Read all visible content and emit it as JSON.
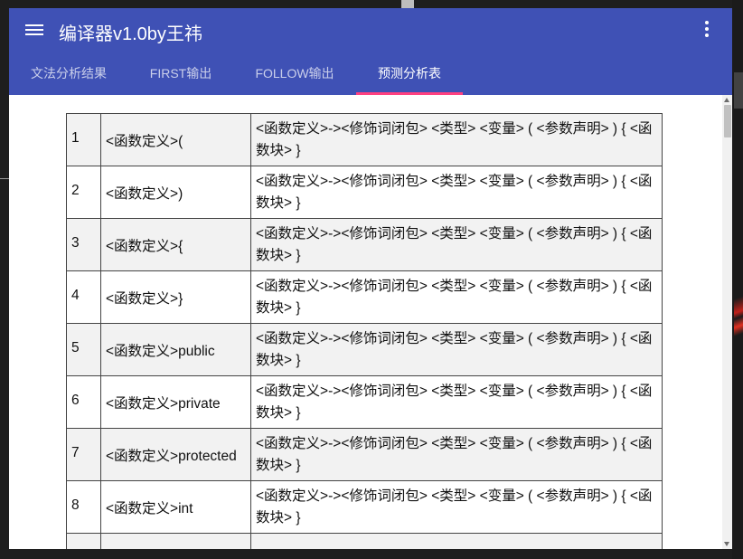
{
  "app": {
    "title": "编译器v1.0by王祎"
  },
  "tabs": [
    {
      "label": "文法分析结果",
      "active": false
    },
    {
      "label": "FIRST输出",
      "active": false
    },
    {
      "label": "FOLLOW输出",
      "active": false
    },
    {
      "label": "预测分析表",
      "active": true
    }
  ],
  "colors": {
    "appbar": "#3f51b5",
    "indicator": "#ff4081"
  },
  "icons": {
    "menu": "menu-icon",
    "more": "more-vert-icon"
  },
  "table": {
    "rows": [
      {
        "no": "1",
        "key": "<函数定义>(",
        "production": "<函数定义>-><修饰词闭包> <类型> <变量> ( <参数声明> ) { <函数块> }"
      },
      {
        "no": "2",
        "key": "<函数定义>)",
        "production": "<函数定义>-><修饰词闭包> <类型> <变量> ( <参数声明> ) { <函数块> }"
      },
      {
        "no": "3",
        "key": "<函数定义>{",
        "production": "<函数定义>-><修饰词闭包> <类型> <变量> ( <参数声明> ) { <函数块> }"
      },
      {
        "no": "4",
        "key": "<函数定义>}",
        "production": "<函数定义>-><修饰词闭包> <类型> <变量> ( <参数声明> ) { <函数块> }"
      },
      {
        "no": "5",
        "key": "<函数定义>public",
        "production": "<函数定义>-><修饰词闭包> <类型> <变量> ( <参数声明> ) { <函数块> }"
      },
      {
        "no": "6",
        "key": "<函数定义>private",
        "production": "<函数定义>-><修饰词闭包> <类型> <变量> ( <参数声明> ) { <函数块> }"
      },
      {
        "no": "7",
        "key": "<函数定义>protected",
        "production": "<函数定义>-><修饰词闭包> <类型> <变量> ( <参数声明> ) { <函数块> }"
      },
      {
        "no": "8",
        "key": "<函数定义>int",
        "production": "<函数定义>-><修饰词闭包> <类型> <变量> ( <参数声明> ) { <函数块> }"
      },
      {
        "no": "",
        "key": "",
        "production": ""
      }
    ]
  }
}
